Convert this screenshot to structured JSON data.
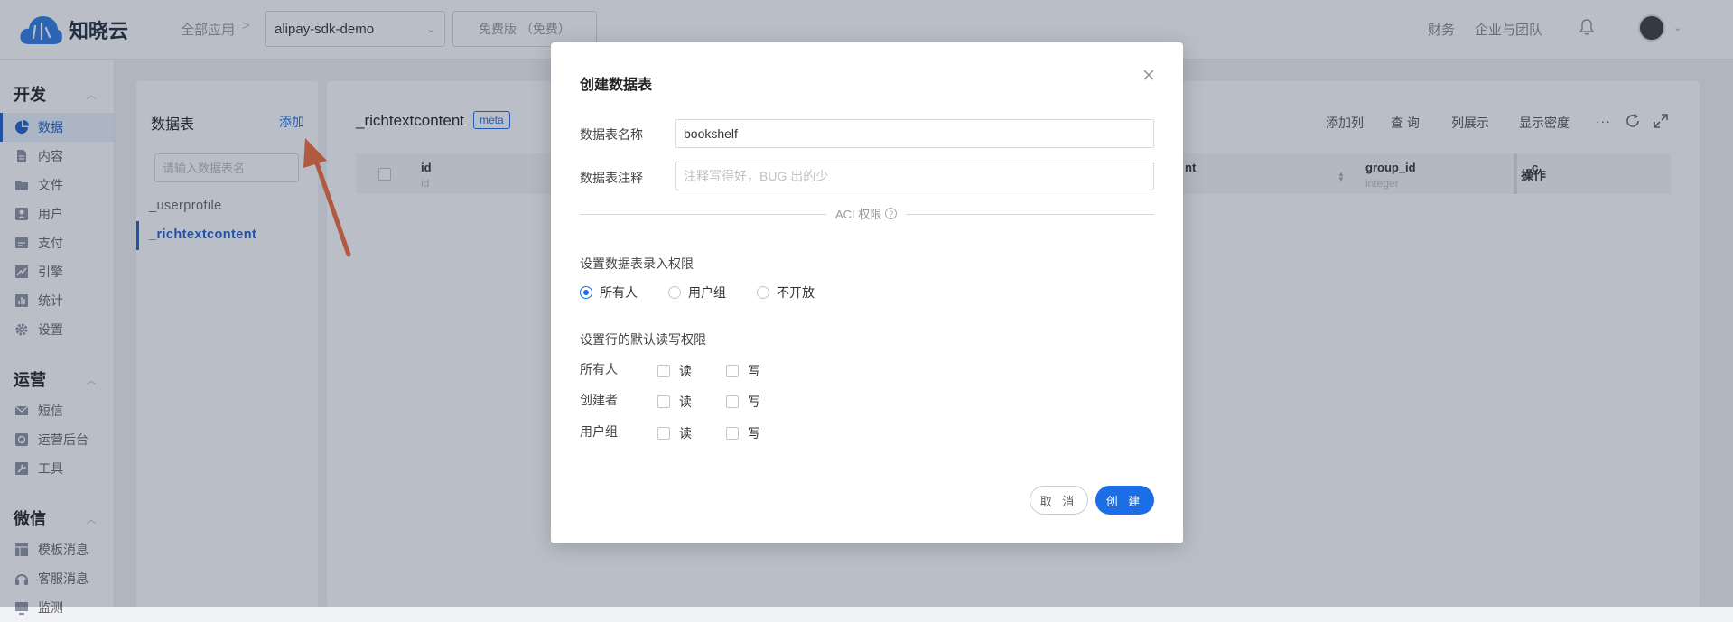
{
  "header": {
    "brand": "知晓云",
    "all_apps": "全部应用",
    "separator": ">",
    "app_select": "alipay-sdk-demo",
    "plan": "免费版 （免费）",
    "finance": "财务",
    "enterprise": "企业与团队"
  },
  "sidebar": {
    "groups": [
      {
        "title": "开发",
        "items": [
          "数据",
          "内容",
          "文件",
          "用户",
          "支付",
          "引擎",
          "统计",
          "设置"
        ]
      },
      {
        "title": "运营",
        "items": [
          "短信",
          "运营后台",
          "工具"
        ]
      },
      {
        "title": "微信",
        "items": [
          "模板消息",
          "客服消息",
          "监测"
        ]
      }
    ],
    "active_item": "数据"
  },
  "tables_panel": {
    "title": "数据表",
    "add_label": "添加",
    "search_placeholder": "请输入数据表名",
    "items": [
      "_userprofile",
      "_richtextcontent"
    ],
    "active_item": "_richtextcontent"
  },
  "main": {
    "table_name": "_richtextcontent",
    "meta_badge": "meta",
    "toolbar": [
      "添加列",
      "查 询",
      "列展示",
      "显示密度"
    ],
    "more": "···",
    "columns": [
      {
        "name": "id",
        "type": "id"
      },
      {
        "name": "nt",
        "type": ""
      },
      {
        "name": "group_id",
        "type": "integer"
      },
      {
        "name": "c",
        "type": ""
      }
    ],
    "operation_header": "操作"
  },
  "modal": {
    "title": "创建数据表",
    "name_label": "数据表名称",
    "name_value": "bookshelf",
    "comment_label": "数据表注释",
    "comment_placeholder": "注释写得好，BUG 出的少",
    "acl_label": "ACL权限",
    "acl_help": "?",
    "entry_section": "设置数据表录入权限",
    "entry_options": [
      "所有人",
      "用户组",
      "不开放"
    ],
    "entry_selected": "所有人",
    "row_section": "设置行的默认读写权限",
    "row_permissions": [
      {
        "role": "所有人",
        "read": "读",
        "write": "写"
      },
      {
        "role": "创建者",
        "read": "读",
        "write": "写"
      },
      {
        "role": "用户组",
        "read": "读",
        "write": "写"
      }
    ],
    "cancel": "取 消",
    "create": "创 建"
  },
  "colors": {
    "primary": "#1c6ee6",
    "annotation_arrow": "#f26a3c"
  }
}
